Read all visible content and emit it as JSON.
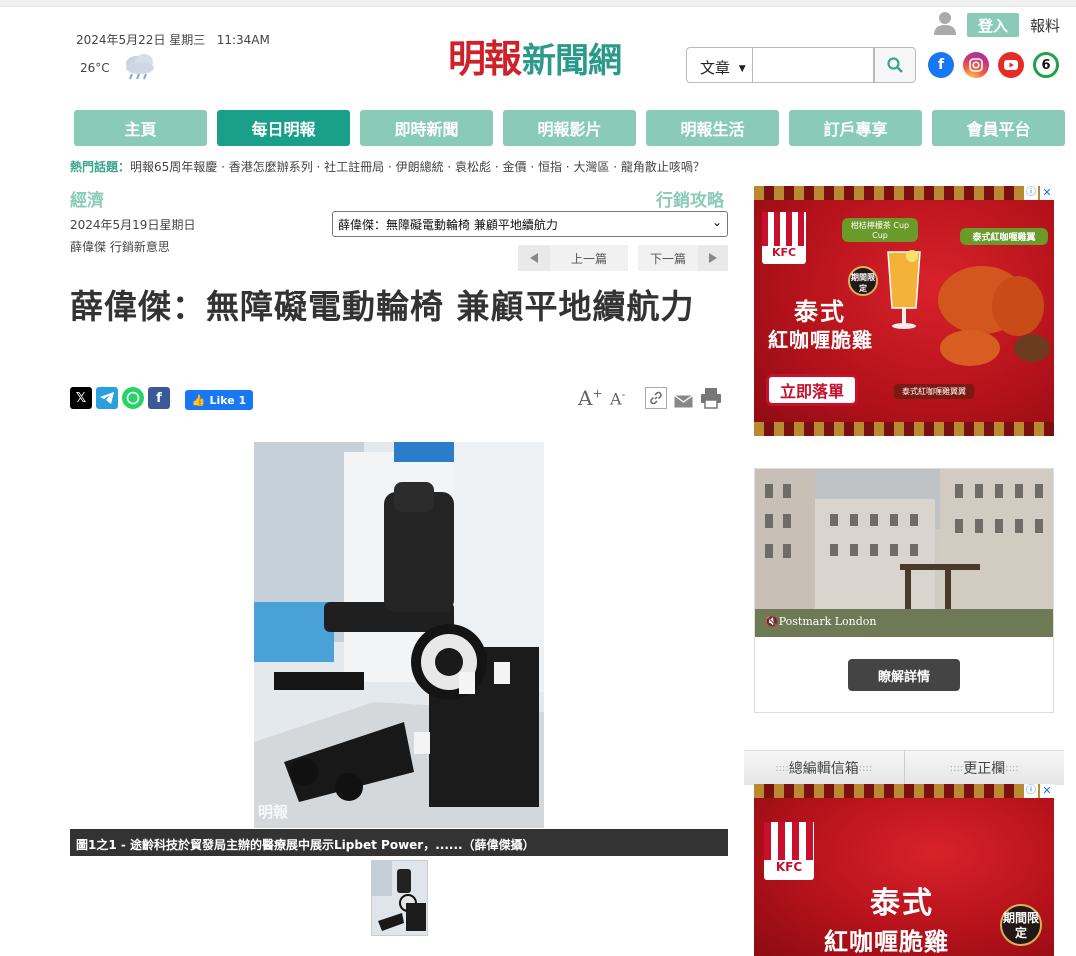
{
  "header": {
    "date": "2024年5月22日 星期三",
    "time": "11:34AM",
    "temperature": "26°C",
    "weather_icon": "rain-cloud-icon",
    "logo_main": "明報",
    "logo_sub": "新聞網",
    "search_type": "文章",
    "search_placeholder": "",
    "login_label": "登入",
    "report_label": "報料",
    "social": [
      "facebook",
      "instagram",
      "youtube",
      "six"
    ]
  },
  "nav": {
    "tabs": [
      "主頁",
      "每日明報",
      "即時新聞",
      "明報影片",
      "明報生活",
      "訂戶專享",
      "會員平台"
    ],
    "active_index": 1
  },
  "hot_topics": {
    "label": "熱門話題：",
    "text": "明報65周年報慶 · 香港怎麼辦系列 · 社工註冊局 · 伊朗總統 · 袁松彪 · 金價 · 恒指 · 大灣區 · 龍角散止咳喎？"
  },
  "article": {
    "section": "經濟",
    "column": "行銷攻略",
    "date": "2024年5月19日星期日",
    "byline": "薛偉傑 行銷新意思",
    "select_value": "薛偉傑：無障礙電動輪椅 兼顧平地續航力",
    "prev_label": "上一篇",
    "next_label": "下一篇",
    "title": "薛偉傑：無障礙電動輪椅 兼顧平地續航力",
    "like_label": "Like 1",
    "font_up": "A",
    "font_down": "A",
    "caption": "圖1之1 - 途齡科技於貿發局主辦的醫療展中展示Lipbet Power，......（薛偉傑攝）",
    "watermark": "明報"
  },
  "sidebar": {
    "ad1": {
      "brand": "KFC",
      "line1": "泰式",
      "line2": "紅咖喱脆雞",
      "drink": "柑桔檸檬茶 Cup Cup",
      "product": "泰式紅咖喱雞翼",
      "badge": "期間限定",
      "cta": "立即落單",
      "combo": "泰式紅咖喱雞翼翼"
    },
    "ad2": {
      "brand_text": "Postmark London",
      "cta": "瞭解詳情"
    },
    "links": [
      "總編輯信箱",
      "更正欄"
    ],
    "ad3": {
      "brand": "KFC",
      "line1": "泰式",
      "line2": "紅咖喱脆雞",
      "badge": "期間限定"
    }
  },
  "colors": {
    "nav": "#8acbb7",
    "nav_active": "#1aa08a",
    "accent_green": "#3aa58d",
    "logo_red": "#d0202a"
  }
}
